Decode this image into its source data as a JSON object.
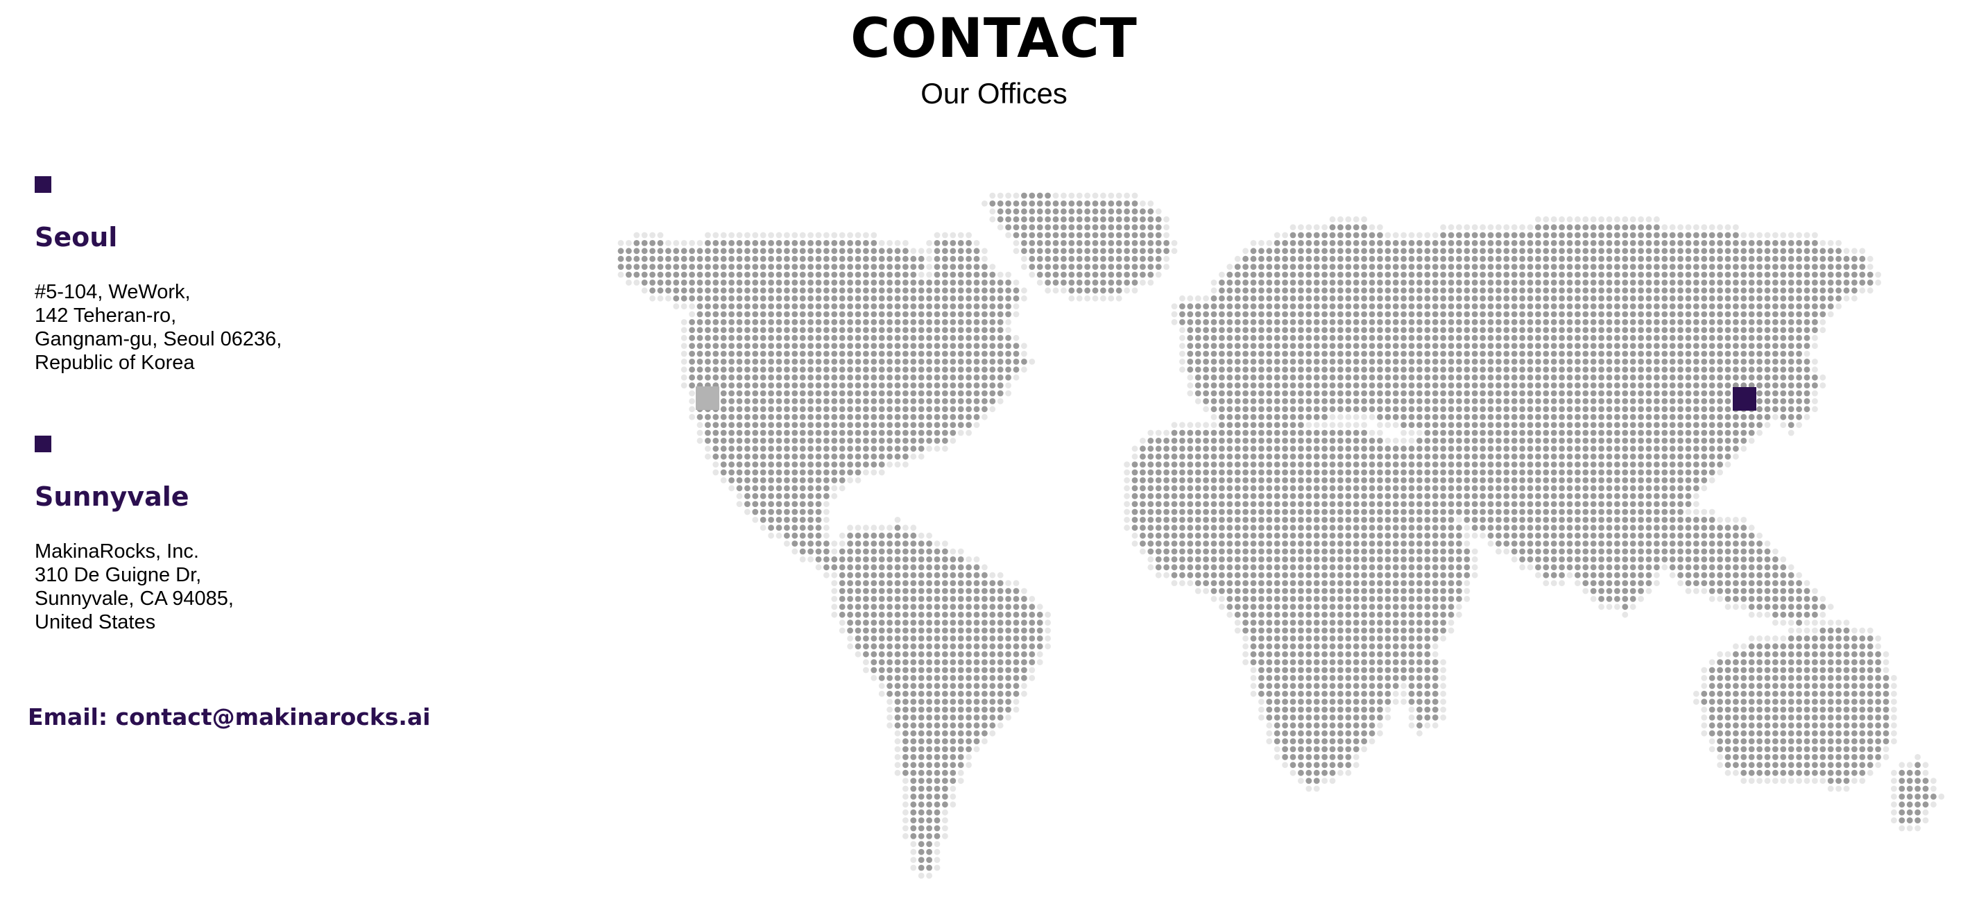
{
  "header": {
    "title": "CONTACT",
    "subtitle": "Our Offices"
  },
  "colors": {
    "brand": "#2b0f4f",
    "land_dot": "#999999",
    "coast_dot": "#e6e6e6",
    "inactive_pin": "#b3b3b3"
  },
  "offices": [
    {
      "name": "Seoul",
      "address_lines": [
        "#5-104, WeWork,",
        "142 Teheran-ro,",
        "Gangnam-gu, Seoul 06236,",
        "Republic of Korea"
      ]
    },
    {
      "name": "Sunnyvale",
      "address_lines": [
        "MakinaRocks, Inc.",
        "310 De Guigne Dr,",
        "Sunnyvale, CA 94085,",
        "United States"
      ]
    }
  ],
  "contact": {
    "email_label": "Email:",
    "email": "contact@makinarocks.ai"
  },
  "map": {
    "icon": "dotted-world-map"
  }
}
